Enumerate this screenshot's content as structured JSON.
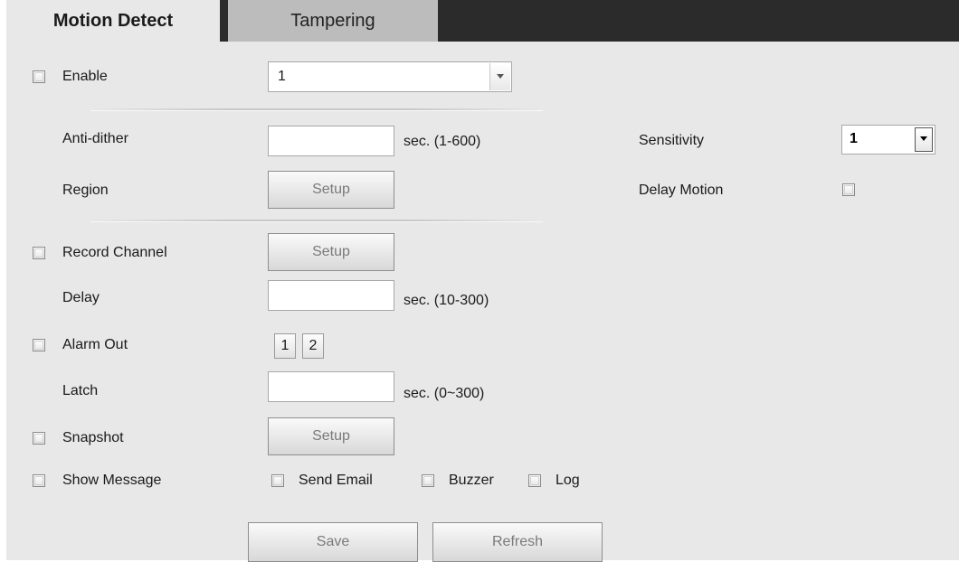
{
  "tabs": [
    {
      "label": "Motion Detect",
      "active": true
    },
    {
      "label": "Tampering",
      "active": false
    }
  ],
  "enable": {
    "label": "Enable",
    "checked": false,
    "channel_value": "1"
  },
  "anti_dither": {
    "label": "Anti-dither",
    "value": "",
    "unit": "sec. (1-600)"
  },
  "sensitivity": {
    "label": "Sensitivity",
    "value": "1"
  },
  "region": {
    "label": "Region",
    "button": "Setup"
  },
  "delay_motion": {
    "label": "Delay Motion",
    "checked": false
  },
  "record_channel": {
    "label": "Record Channel",
    "checked": false,
    "button": "Setup"
  },
  "delay": {
    "label": "Delay",
    "value": "",
    "unit": "sec.  (10-300)"
  },
  "alarm_out": {
    "label": "Alarm Out",
    "checked": false,
    "outputs": [
      "1",
      "2"
    ]
  },
  "latch": {
    "label": "Latch",
    "value": "",
    "unit": "sec.  (0~300)"
  },
  "snapshot": {
    "label": "Snapshot",
    "checked": false,
    "button": "Setup"
  },
  "show_message": {
    "label": "Show Message",
    "checked": false
  },
  "send_email": {
    "label": "Send Email",
    "checked": false
  },
  "buzzer": {
    "label": "Buzzer",
    "checked": false
  },
  "log": {
    "label": "Log",
    "checked": false
  },
  "actions": {
    "save": "Save",
    "refresh": "Refresh"
  }
}
